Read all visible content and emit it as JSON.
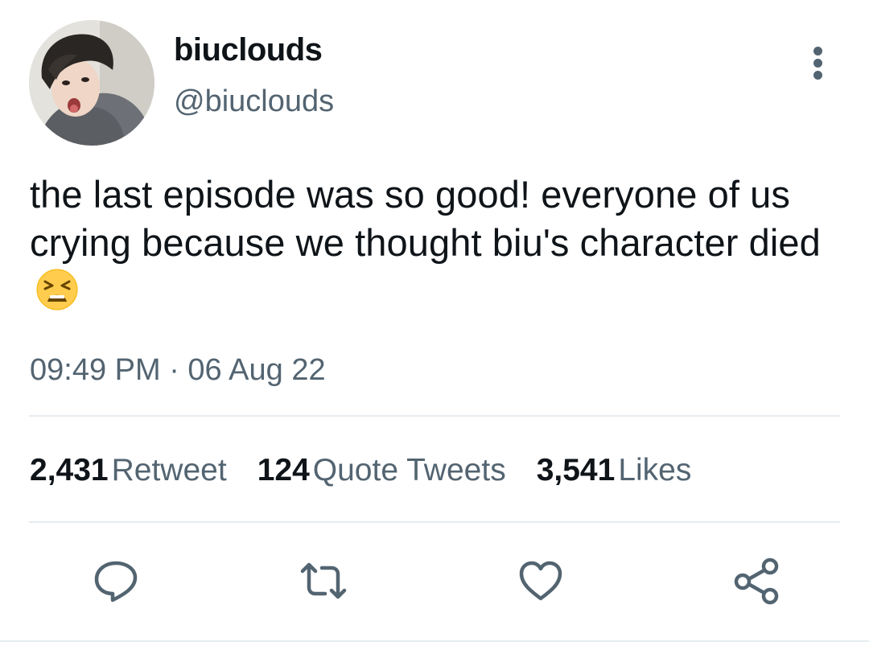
{
  "tweet": {
    "display_name": "biuclouds",
    "handle": "@biuclouds",
    "text": "the last episode was so good! everyone of us crying because we thought biu's character died",
    "emoji": "tired-face-emoji",
    "timestamp": "09:49 PM · 06 Aug 22",
    "more_icon": "more-vertical-icon"
  },
  "stats": [
    {
      "count": "2,431",
      "label": "Retweet"
    },
    {
      "count": "124",
      "label": "Quote Tweets"
    },
    {
      "count": "3,541",
      "label": "Likes"
    }
  ],
  "actions": [
    {
      "icon": "reply-icon"
    },
    {
      "icon": "retweet-icon"
    },
    {
      "icon": "like-icon"
    },
    {
      "icon": "share-icon"
    }
  ],
  "colors": {
    "text_primary": "#0f1419",
    "text_secondary": "#536471",
    "divider": "#e6ecf0"
  }
}
